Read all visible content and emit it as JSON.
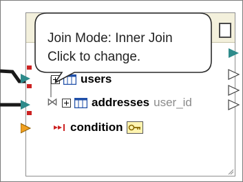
{
  "tooltip": {
    "line1": "Join Mode: Inner Join",
    "line2": "Click to change."
  },
  "tree": {
    "users_label": "users",
    "addresses_label": "addresses",
    "addresses_column": "user_id",
    "condition_label": "condition"
  },
  "icons": {
    "join": "⋈",
    "table": "table-icon",
    "key": "key-icon",
    "expand": "expand-icon"
  },
  "colors": {
    "connector_teal": "#2e8b8b",
    "connector_orange": "#f0a020",
    "connector_red": "#cc2222",
    "link_line": "#1a1a1a",
    "header_bg": "#f3f0dc"
  }
}
